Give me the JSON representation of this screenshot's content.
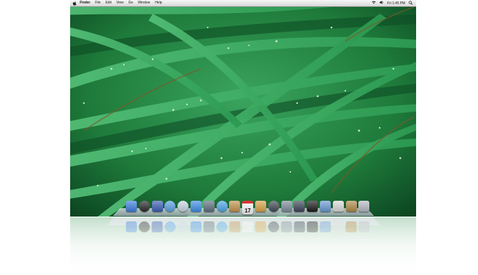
{
  "menubar": {
    "app_name": "Finder",
    "menus": [
      "File",
      "Edit",
      "View",
      "Go",
      "Window",
      "Help"
    ],
    "clock": "Fri 1:45 PM"
  },
  "icons": {
    "apple": "apple-logo-icon",
    "wifi": "wifi-icon",
    "volume": "volume-icon",
    "spotlight": "spotlight-search-icon"
  },
  "dock": {
    "items": [
      {
        "name": "finder-icon",
        "color": "#3f7ede"
      },
      {
        "name": "dashboard-icon",
        "color": "#2b2b2b"
      },
      {
        "name": "spaces-icon",
        "color": "#3b5fb6"
      },
      {
        "name": "safari-icon",
        "color": "#5aa0e6"
      },
      {
        "name": "mail-icon",
        "color": "#c9d6e6"
      },
      {
        "name": "ichat-icon",
        "color": "#3f8fe6"
      },
      {
        "name": "photo-icon",
        "color": "#607080"
      },
      {
        "name": "itunes-icon",
        "color": "#4fa6e8"
      },
      {
        "name": "address-book-icon",
        "color": "#c2934f"
      },
      {
        "name": "ical-icon",
        "color": "#f4f4f4",
        "label": "17"
      },
      {
        "name": "garageband-icon",
        "color": "#d8a348"
      },
      {
        "name": "time-machine-icon",
        "color": "#444b55"
      },
      {
        "name": "iphoto-icon",
        "color": "#7f8d9b"
      },
      {
        "name": "imovie-icon",
        "color": "#3e4658"
      },
      {
        "name": "dvd-player-icon",
        "color": "#1c1c1c"
      },
      {
        "name": "iweb-icon",
        "color": "#6a9ad2"
      },
      {
        "name": "preview-icon",
        "color": "#d9d9d9"
      },
      {
        "name": "documents-folder-icon",
        "color": "#b08a4a"
      },
      {
        "name": "trash-icon",
        "color": "#b7bcc3"
      }
    ]
  }
}
